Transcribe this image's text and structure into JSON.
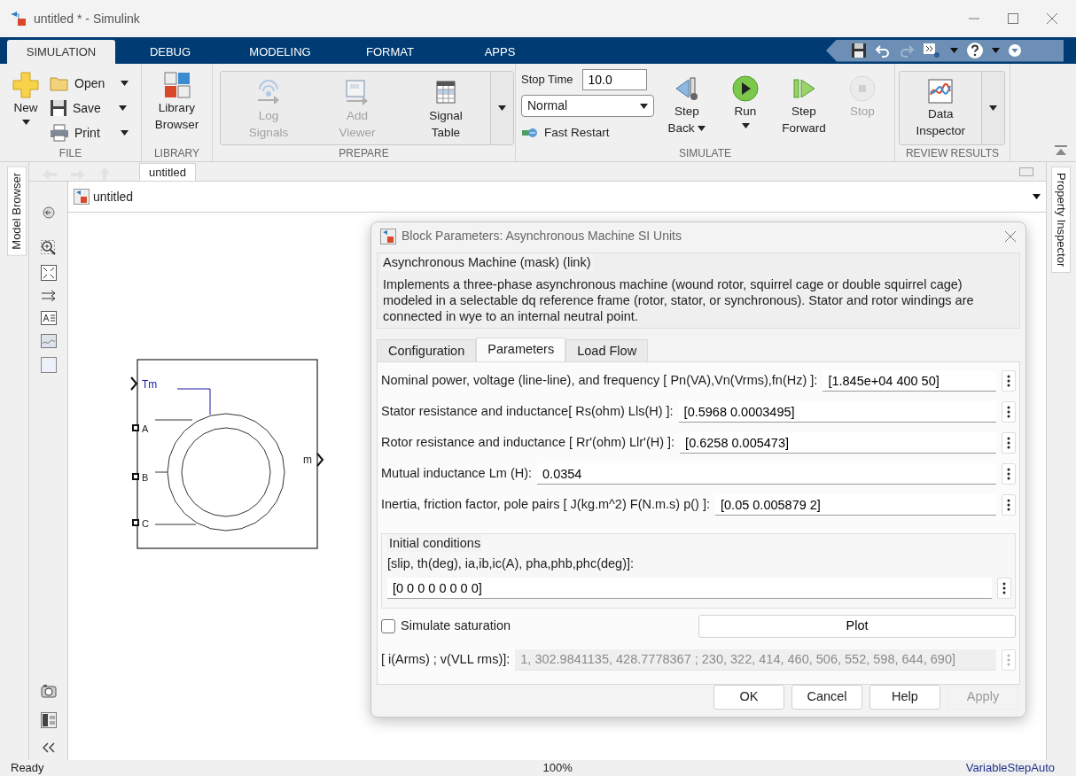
{
  "window": {
    "title": "untitled * - Simulink"
  },
  "tabs": [
    {
      "label": "SIMULATION",
      "selected": true
    },
    {
      "label": "DEBUG",
      "selected": false
    },
    {
      "label": "MODELING",
      "selected": false
    },
    {
      "label": "FORMAT",
      "selected": false
    },
    {
      "label": "APPS",
      "selected": false
    }
  ],
  "ribbon": {
    "file": {
      "title": "FILE",
      "new": {
        "label": "New",
        "menu": true
      },
      "small": [
        {
          "label": "Open",
          "menu": true
        },
        {
          "label": "Save",
          "menu": true
        },
        {
          "label": "Print",
          "menu": true
        }
      ]
    },
    "library": {
      "title": "LIBRARY",
      "browser": {
        "label": "Library\nBrowser"
      }
    },
    "prepare": {
      "title": "PREPARE",
      "items": [
        {
          "label": "Log\nSignals",
          "disabled": true
        },
        {
          "label": "Add\nViewer",
          "disabled": true
        },
        {
          "label": "Signal\nTable",
          "disabled": false
        }
      ]
    },
    "simulate": {
      "title": "SIMULATE",
      "stop_time": {
        "label": "Stop Time",
        "value": "10.0"
      },
      "mode": {
        "value": "Normal"
      },
      "fast_restart": {
        "label": "Fast Restart"
      },
      "buttons": [
        {
          "label": "Step\nBack",
          "menu": true,
          "disabled": false
        },
        {
          "label": "Run",
          "menu": true,
          "disabled": false
        },
        {
          "label": "Step\nForward",
          "menu": false,
          "disabled": false
        },
        {
          "label": "Stop",
          "menu": false,
          "disabled": true
        }
      ]
    },
    "review": {
      "title": "REVIEW RESULTS",
      "inspector": {
        "label": "Data\nInspector"
      }
    }
  },
  "side_tabs": {
    "left": "Model Browser",
    "right": "Property Inspector"
  },
  "model": {
    "breadcrumb": "untitled",
    "address": "untitled",
    "block": {
      "inputs": [
        {
          "label": "Tm",
          "kind": "signal"
        },
        {
          "label": "A",
          "kind": "conserving"
        },
        {
          "label": "B",
          "kind": "conserving"
        },
        {
          "label": "C",
          "kind": "conserving"
        }
      ],
      "outputs": [
        {
          "label": "m",
          "kind": "signal"
        }
      ]
    }
  },
  "dialog": {
    "title": "Block Parameters: Asynchronous Machine SI Units",
    "group_title": "Asynchronous Machine (mask) (link)",
    "description": "Implements a three-phase asynchronous machine (wound rotor, squirrel cage or double squirrel cage) modeled in a selectable dq reference frame (rotor, stator, or synchronous). Stator and rotor windings are connected in wye to an internal neutral point.",
    "tabs": [
      {
        "label": "Configuration",
        "selected": false
      },
      {
        "label": "Parameters",
        "selected": true
      },
      {
        "label": "Load Flow",
        "selected": false
      }
    ],
    "parameters": [
      {
        "label": "Nominal power, voltage (line-line), and frequency [ Pn(VA),Vn(Vrms),fn(Hz) ]:",
        "value": "[1.845e+04 400 50]"
      },
      {
        "label": "Stator resistance and inductance[ Rs(ohm)  Lls(H) ]:",
        "value": "[0.5968 0.0003495]"
      },
      {
        "label": "Rotor resistance and inductance [ Rr'(ohm)  Llr'(H) ]:",
        "value": "[0.6258 0.005473]"
      },
      {
        "label": "Mutual inductance Lm (H):",
        "value": "0.0354"
      },
      {
        "label": "Inertia, friction factor, pole pairs [ J(kg.m^2)  F(N.m.s)   p() ]:",
        "value": "[0.05 0.005879 2]"
      }
    ],
    "initial_conditions": {
      "title": "Initial conditions",
      "label": "[slip, th(deg), ia,ib,ic(A), pha,phb,phc(deg)]:",
      "value": "[0 0 0 0 0 0 0 0]"
    },
    "saturation": {
      "label": "Simulate saturation",
      "checked": false
    },
    "plot_button": "Plot",
    "saturation_table": {
      "label": "[ i(Arms) ; v(VLL rms)]:",
      "value": "1, 302.9841135, 428.7778367 ; 230, 322, 414, 460, 506, 552, 598, 644, 690]",
      "disabled": true
    },
    "buttons": [
      {
        "label": "OK",
        "disabled": false
      },
      {
        "label": "Cancel",
        "disabled": false
      },
      {
        "label": "Help",
        "disabled": false
      },
      {
        "label": "Apply",
        "disabled": true
      }
    ]
  },
  "status_bar": {
    "left": "Ready",
    "center": "100%",
    "right": "VariableStepAuto"
  }
}
